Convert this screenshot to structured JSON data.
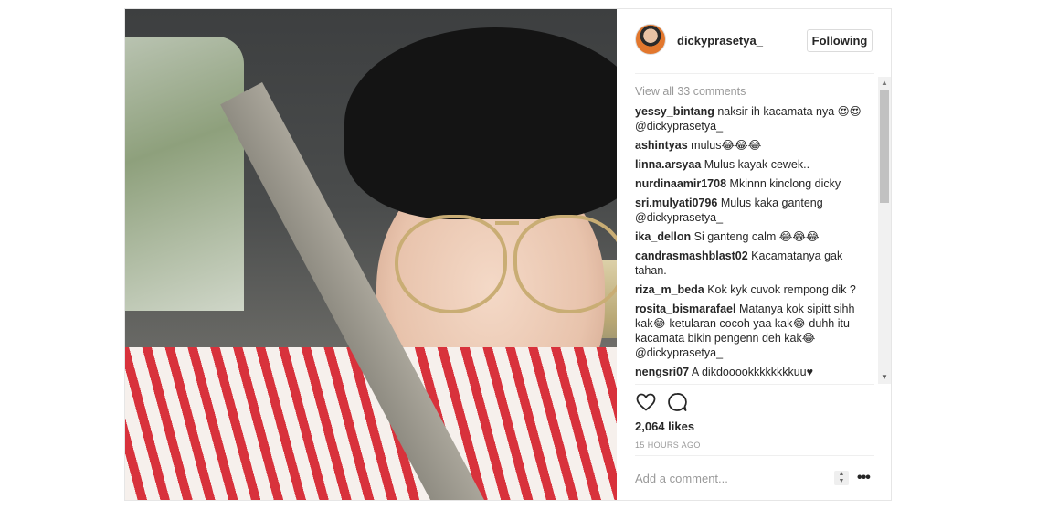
{
  "post": {
    "username": "dickyprasetya_",
    "follow_label": "Following",
    "view_all": "View all 33 comments",
    "comments": [
      {
        "user": "yessy_bintang",
        "text": "naksir ih kacamata nya 😍😍 @dickyprasetya_"
      },
      {
        "user": "ashintyas",
        "text": "mulus😂😂😂"
      },
      {
        "user": "linna.arsyaa",
        "text": "Mulus kayak cewek.."
      },
      {
        "user": "nurdinaamir1708",
        "text": "Mkinnn kinclong dicky"
      },
      {
        "user": "sri.mulyati0796",
        "text": "Mulus kaka ganteng @dickyprasetya_"
      },
      {
        "user": "ika_dellon",
        "text": "Si ganteng calm 😂😂😂"
      },
      {
        "user": "candrasmashblast02",
        "text": "Kacamatanya gak tahan."
      },
      {
        "user": "riza_m_beda",
        "text": "Kok kyk cuvok rempong dik ?"
      },
      {
        "user": "rosita_bismarafael",
        "text": "Matanya kok sipitt sihh kak😂 ketularan cocoh yaa kak😂 duhh itu kacamata bikin pengenn deh kak😂 @dickyprasetya_"
      },
      {
        "user": "nengsri07",
        "text": "A dikdooookkkkkkkkuu♥"
      }
    ],
    "likes": "2,064 likes",
    "time": "15 HOURS AGO",
    "comment_placeholder": "Add a comment...",
    "more_label": "•••",
    "icons": {
      "like": "heart-icon",
      "comment": "comment-bubble-icon"
    }
  }
}
